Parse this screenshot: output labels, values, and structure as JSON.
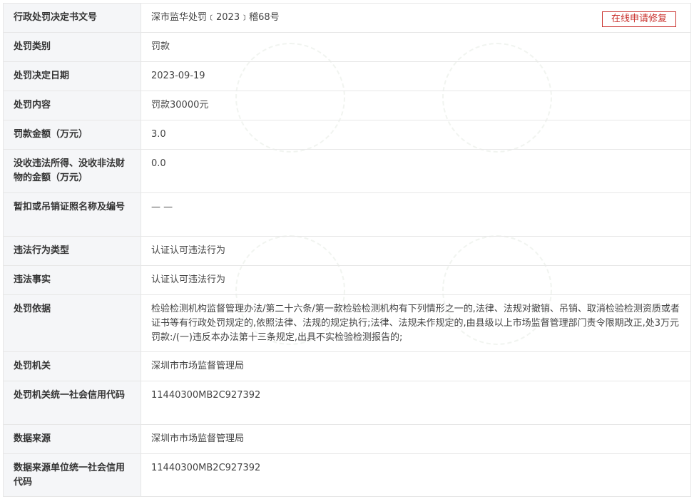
{
  "repair_button_label": "在线申请修复",
  "rows": [
    {
      "label": "行政处罚决定书文号",
      "value": "深市监华处罚﹝2023﹞稽68号"
    },
    {
      "label": "处罚类别",
      "value": "罚款"
    },
    {
      "label": "处罚决定日期",
      "value": "2023-09-19"
    },
    {
      "label": "处罚内容",
      "value": "罚款30000元"
    },
    {
      "label": "罚款金额（万元）",
      "value": "3.0"
    },
    {
      "label": "没收违法所得、没收非法财物的金额（万元）",
      "value": "0.0"
    },
    {
      "label": "暂扣或吊销证照名称及编号",
      "value": "— —"
    },
    {
      "label": "违法行为类型",
      "value": "认证认可违法行为"
    },
    {
      "label": "违法事实",
      "value": "认证认可违法行为"
    },
    {
      "label": "处罚依据",
      "value": "检验检测机构监督管理办法/第二十六条/第一款检验检测机构有下列情形之一的,法律、法规对撤销、吊销、取消检验检测资质或者证书等有行政处罚规定的,依照法律、法规的规定执行;法律、法规未作规定的,由县级以上市场监督管理部门责令限期改正,处3万元罚款:/(一)违反本办法第十三条规定,出具不实检验检测报告的;"
    },
    {
      "label": "处罚机关",
      "value": "深圳市市场监督管理局"
    },
    {
      "label": "处罚机关统一社会信用代码",
      "value": "11440300MB2C927392"
    },
    {
      "label": "数据来源",
      "value": "深圳市市场监督管理局"
    },
    {
      "label": "数据来源单位统一社会信用代码",
      "value": "11440300MB2C927392"
    }
  ]
}
